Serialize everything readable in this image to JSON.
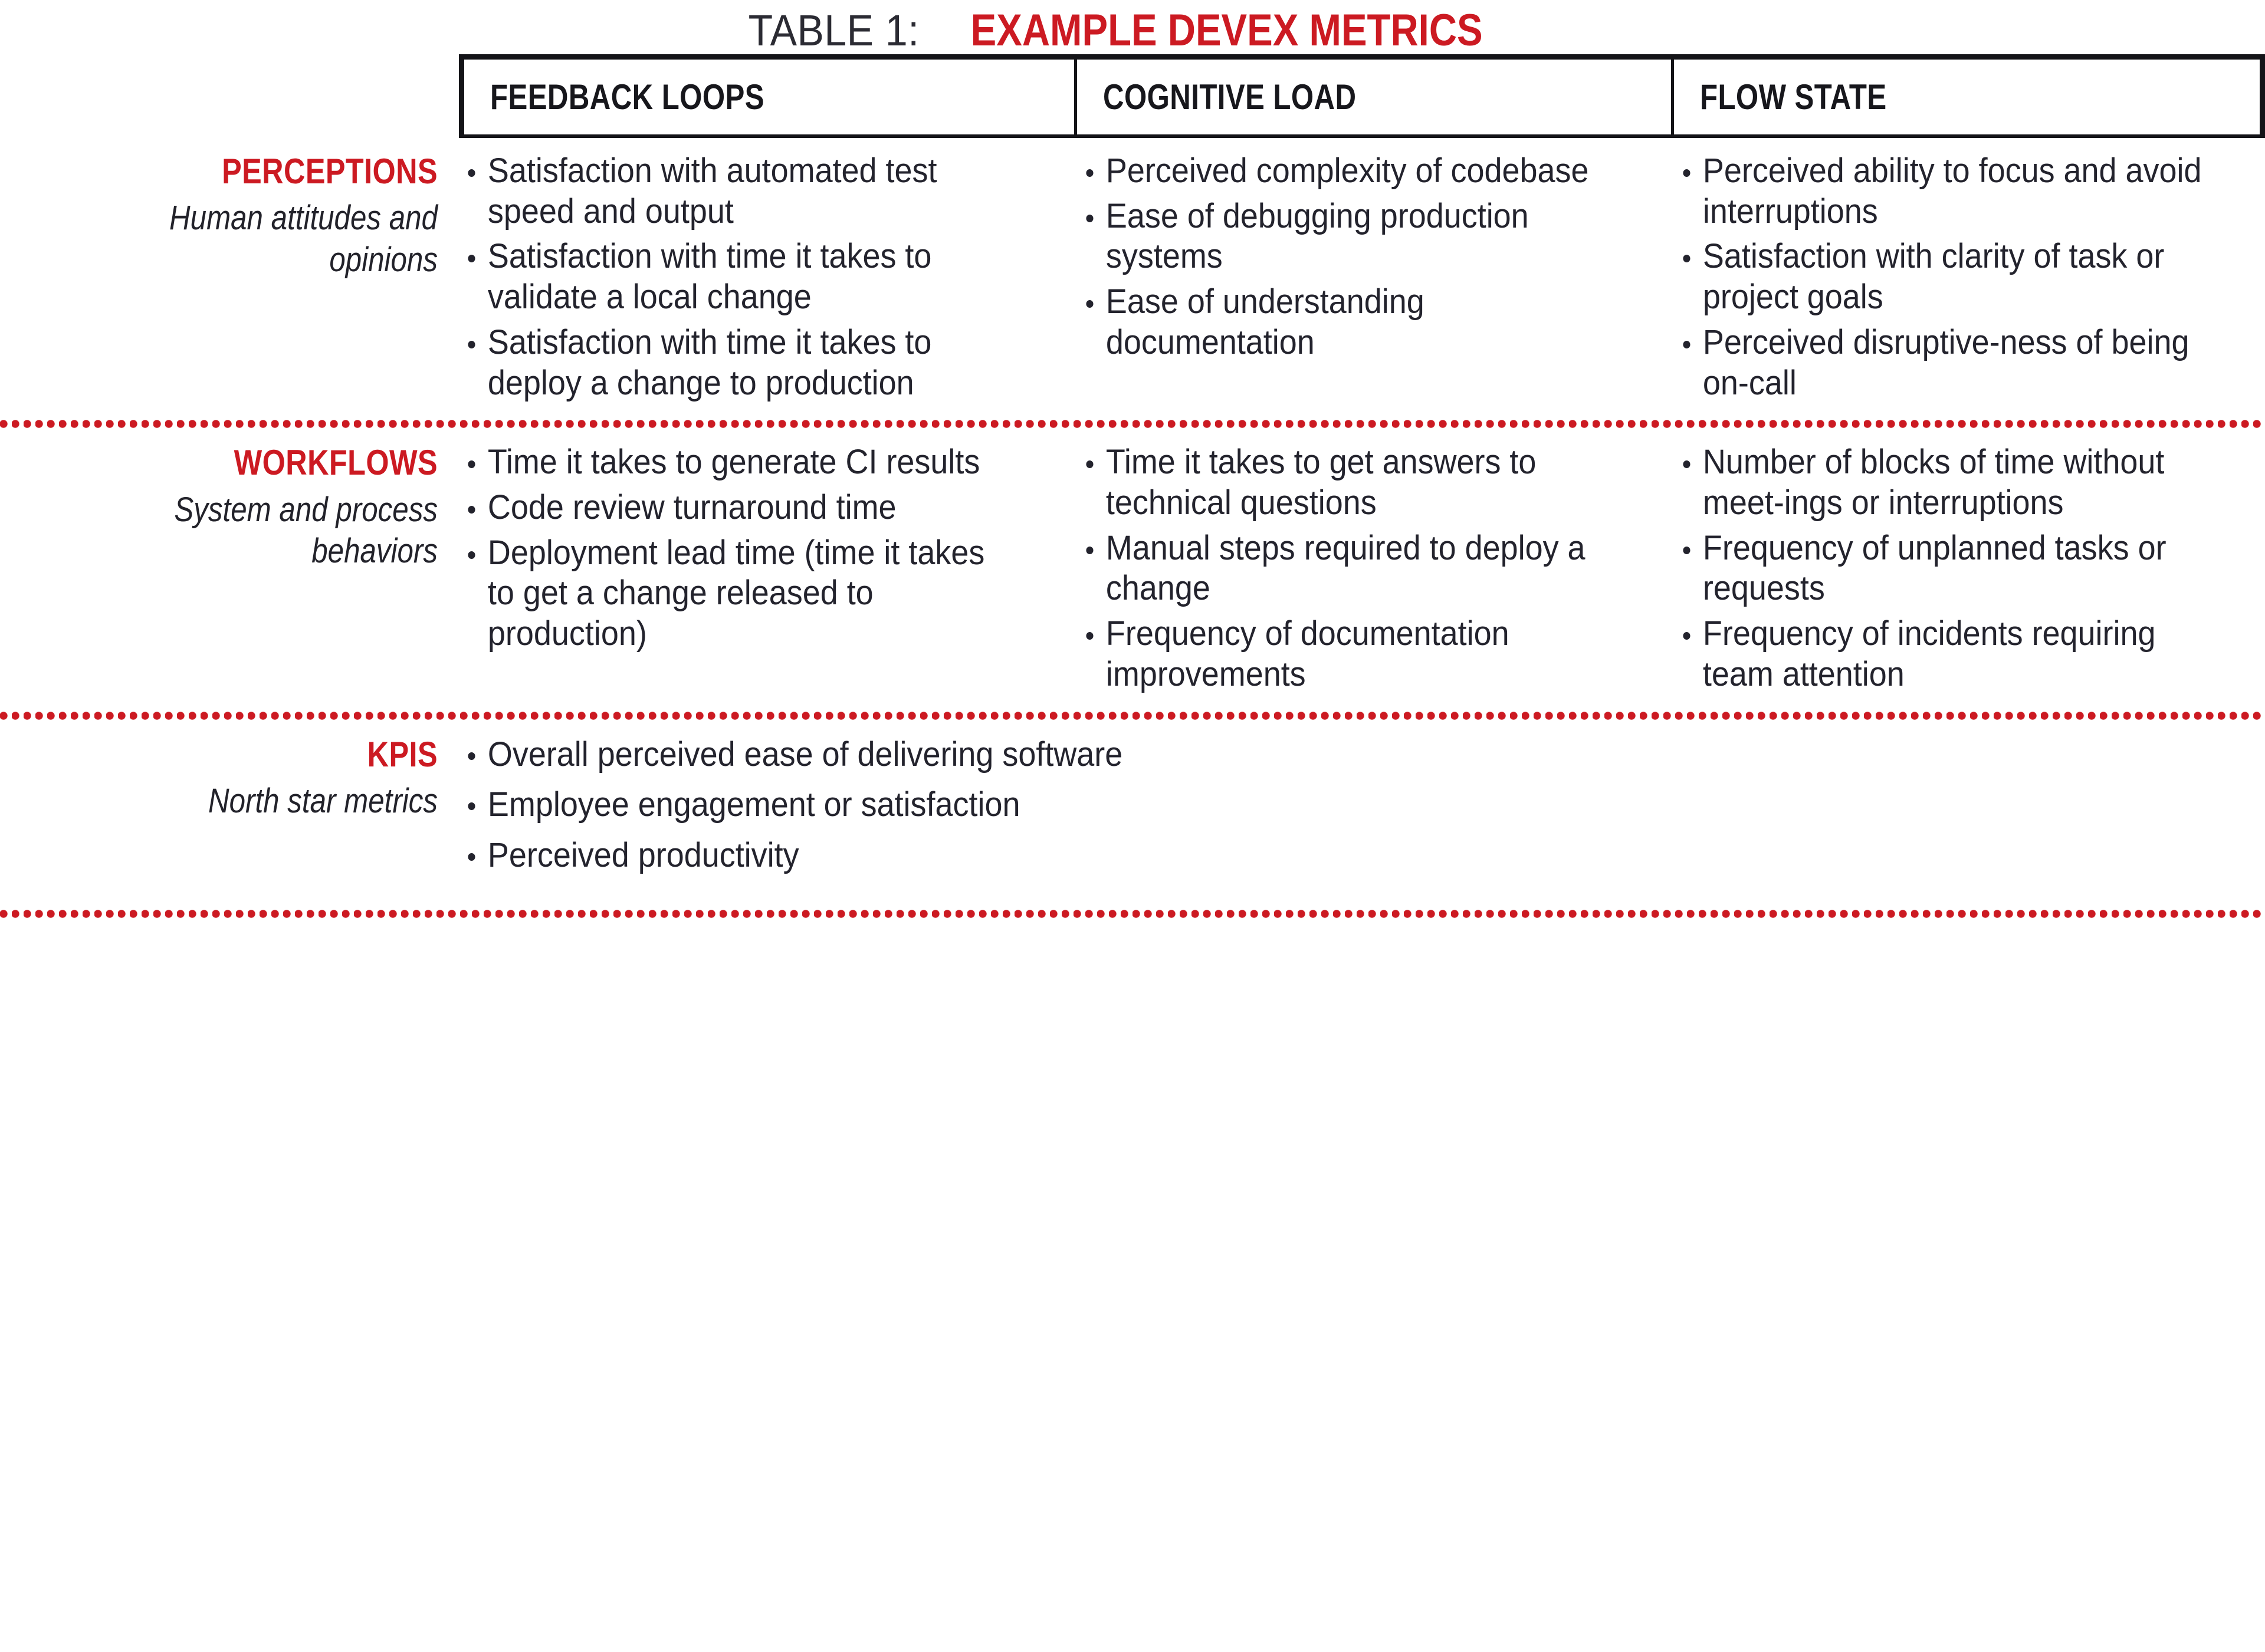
{
  "title": {
    "prefix": "TABLE 1:",
    "main": "EXAMPLE DEVEX METRICS",
    "accent_color": "#CC1A22",
    "prefix_color": "#2B2B33"
  },
  "columns": [
    {
      "id": "feedback-loops",
      "label": "FEEDBACK LOOPS"
    },
    {
      "id": "cognitive-load",
      "label": "COGNITIVE LOAD"
    },
    {
      "id": "flow-state",
      "label": "FLOW STATE"
    }
  ],
  "rows": [
    {
      "id": "perceptions",
      "category": "PERCEPTIONS",
      "subtitle": "Human attitudes and opinions",
      "cells": {
        "feedback_loops": [
          "Satisfaction with automated test  speed and output",
          "Satisfaction with time it takes to validate a local change",
          "Satisfaction with time it takes to deploy a change to production"
        ],
        "cognitive_load": [
          "Perceived complexity of codebase",
          "Ease of debugging production systems",
          "Ease of understanding documentation"
        ],
        "flow_state": [
          "Perceived ability to focus and avoid interruptions",
          "Satisfaction with clarity of task or project goals",
          "Perceived disruptive-ness of being on-call"
        ]
      }
    },
    {
      "id": "workflows",
      "category": "WORKFLOWS",
      "subtitle": "System and process behaviors",
      "cells": {
        "feedback_loops": [
          "Time it takes to generate CI results",
          "Code review turnaround time",
          "Deployment lead time (time it takes to get a change released to production)"
        ],
        "cognitive_load": [
          "Time it takes to get answers to technical questions",
          "Manual steps required to deploy a change",
          "Frequency of documentation improvements"
        ],
        "flow_state": [
          "Number of blocks of time without meet-ings or interruptions",
          "Frequency of unplanned tasks or requests",
          "Frequency of incidents requiring team attention"
        ]
      }
    },
    {
      "id": "kpis",
      "category": "KPIS",
      "subtitle": "North star metrics",
      "cells": {
        "feedback_loops": [
          "Overall perceived ease of delivering software",
          "Employee engagement or satisfaction",
          "Perceived productivity"
        ],
        "cognitive_load": [],
        "flow_state": []
      }
    }
  ]
}
